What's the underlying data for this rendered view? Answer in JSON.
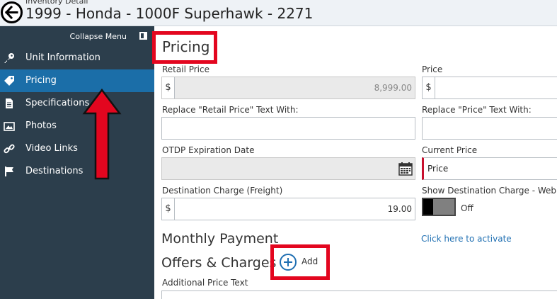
{
  "header": {
    "subtitle": "Inventory Detail",
    "title": "1999 - Honda - 1000F Superhawk - 2271"
  },
  "sidebar": {
    "collapse_label": "Collapse Menu",
    "items": [
      {
        "label": "Unit Information",
        "icon": "key-icon"
      },
      {
        "label": "Pricing",
        "icon": "tag-icon",
        "active": true
      },
      {
        "label": "Specifications",
        "icon": "document-icon"
      },
      {
        "label": "Photos",
        "icon": "image-icon"
      },
      {
        "label": "Video Links",
        "icon": "link-icon"
      },
      {
        "label": "Destinations",
        "icon": "flag-icon"
      }
    ]
  },
  "pricing": {
    "section_title": "Pricing",
    "retail_price": {
      "label": "Retail Price",
      "addon": "$",
      "value": "8,999.00"
    },
    "price": {
      "label": "Price",
      "addon": "$",
      "value": ""
    },
    "replace_retail": {
      "label": "Replace \"Retail Price\" Text With:",
      "value": ""
    },
    "replace_price": {
      "label": "Replace \"Price\" Text With:",
      "value": ""
    },
    "otdp": {
      "label": "OTDP Expiration Date",
      "value": ""
    },
    "current_price": {
      "label": "Current Price",
      "value": "Price"
    },
    "destination_charge": {
      "label": "Destination Charge (Freight)",
      "addon": "$",
      "value": "19.00"
    },
    "show_destination": {
      "label": "Show Destination Charge - Web",
      "state": "Off"
    }
  },
  "monthly": {
    "title": "Monthly Payment",
    "activate_link": "Click here to activate"
  },
  "offers": {
    "title": "Offers & Charges",
    "add_label": "Add"
  },
  "additional": {
    "label": "Additional Price Text"
  },
  "colors": {
    "sidebar_bg": "#2c3e4c",
    "active_bg": "#1b6ea8",
    "highlight": "#e3061f",
    "link": "#1f6fb2"
  }
}
